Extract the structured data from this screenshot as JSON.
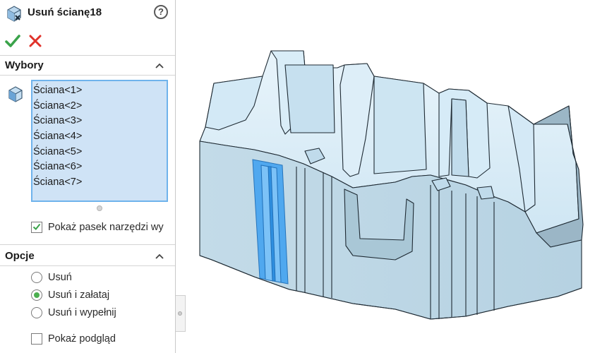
{
  "panel": {
    "title": "Usuń ścianę18",
    "help_icon": "?",
    "icons": {
      "feature": "delete-face-icon",
      "ok": "checkmark-icon",
      "cancel": "close-icon"
    },
    "colors": {
      "ok": "#3aa34a",
      "cancel": "#e0322a",
      "selection_bg": "#cfe3f6",
      "selection_border": "#6fb3ec",
      "highlight_face": "#4aa6f0"
    }
  },
  "selections": {
    "title": "Wybory",
    "items": [
      "Ściana<1>",
      "Ściana<2>",
      "Ściana<3>",
      "Ściana<4>",
      "Ściana<5>",
      "Ściana<6>",
      "Ściana<7>"
    ],
    "show_toolbar_label": "Pokaż pasek narzędzi wy",
    "show_toolbar_checked": true
  },
  "options": {
    "title": "Opcje",
    "radios": [
      {
        "label": "Usuń",
        "selected": false
      },
      {
        "label": "Usuń i załataj",
        "selected": true
      },
      {
        "label": "Usuń i wypełnij",
        "selected": false
      }
    ],
    "preview_label": "Pokaż podgląd",
    "preview_checked": false
  }
}
